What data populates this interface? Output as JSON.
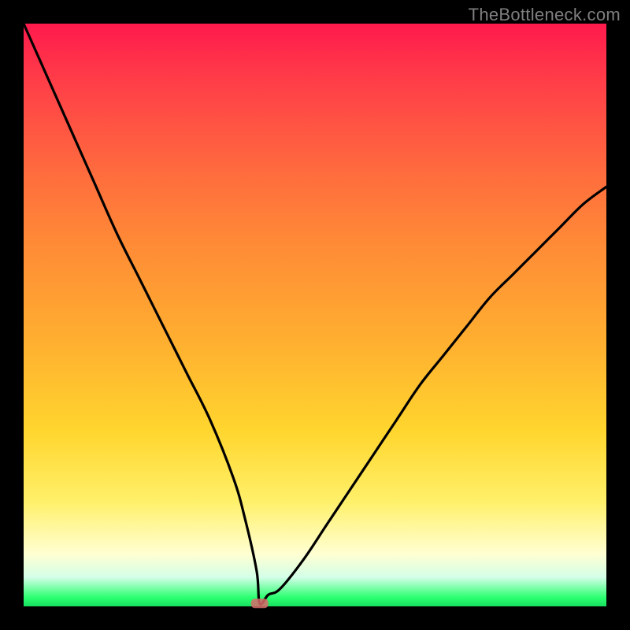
{
  "watermark": "TheBottleneck.com",
  "chart_data": {
    "type": "line",
    "title": "",
    "xlabel": "",
    "ylabel": "",
    "xlim": [
      0,
      100
    ],
    "ylim": [
      0,
      100
    ],
    "grid": false,
    "legend": false,
    "background": "rainbow-vertical-gradient",
    "series": [
      {
        "name": "bottleneck-curve",
        "x": [
          0,
          4,
          8,
          12,
          16,
          20,
          24,
          28,
          32,
          36,
          38,
          40,
          40.5,
          42,
          44,
          48,
          52,
          56,
          60,
          64,
          68,
          72,
          76,
          80,
          84,
          88,
          92,
          96,
          100
        ],
        "y": [
          100,
          91,
          82,
          73,
          64,
          56,
          48,
          40,
          32,
          22,
          15,
          6,
          0.5,
          2,
          3,
          8,
          14,
          20,
          26,
          32,
          38,
          43,
          48,
          53,
          57,
          61,
          65,
          69,
          72
        ]
      }
    ],
    "marker": {
      "x": 40.5,
      "y": 0.5,
      "shape": "rounded-rect",
      "color": "#d96a6a"
    }
  }
}
